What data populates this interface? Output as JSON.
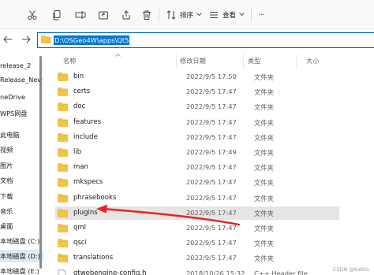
{
  "toolbar": {
    "buttons": [
      {
        "name": "cut-button",
        "icon": "scissors-icon"
      },
      {
        "name": "copy-button",
        "icon": "copy-icon"
      },
      {
        "name": "rename-button",
        "icon": "rename-icon"
      },
      {
        "name": "share-button",
        "icon": "share-icon"
      },
      {
        "name": "delete-button",
        "icon": "trash-icon"
      }
    ],
    "sort_label": "排序",
    "view_label": "查看",
    "more_label": "···"
  },
  "address_bar": {
    "path": "D:\\OSGeo4W\\apps\\Qt5"
  },
  "sidebar": {
    "items": [
      {
        "label": "release_2"
      },
      {
        "label": "Release_New_"
      },
      {
        "label": "neDrive"
      },
      {
        "label": "WPS网盘"
      },
      {
        "label": "此电脑"
      },
      {
        "label": "视频"
      },
      {
        "label": "图片"
      },
      {
        "label": "文档"
      },
      {
        "label": "下载"
      },
      {
        "label": "音乐"
      },
      {
        "label": "桌面"
      },
      {
        "label": "本地磁盘 (C:)"
      },
      {
        "label": "本地磁盘 (D:)"
      },
      {
        "label": "本地磁盘 (E:)"
      }
    ]
  },
  "columns": {
    "name": "名称",
    "date": "修改日期",
    "type": "类型",
    "size": "大小"
  },
  "files": [
    {
      "name": "bin",
      "date": "2022/9/5 17:50",
      "type": "文件夹",
      "size": "",
      "kind": "folder"
    },
    {
      "name": "certs",
      "date": "2022/9/5 17:47",
      "type": "文件夹",
      "size": "",
      "kind": "folder"
    },
    {
      "name": "doc",
      "date": "2022/9/5 17:47",
      "type": "文件夹",
      "size": "",
      "kind": "folder"
    },
    {
      "name": "features",
      "date": "2022/9/5 17:47",
      "type": "文件夹",
      "size": "",
      "kind": "folder"
    },
    {
      "name": "include",
      "date": "2022/9/5 17:47",
      "type": "文件夹",
      "size": "",
      "kind": "folder"
    },
    {
      "name": "lib",
      "date": "2022/9/5 17:49",
      "type": "文件夹",
      "size": "",
      "kind": "folder"
    },
    {
      "name": "man",
      "date": "2022/9/5 17:47",
      "type": "文件夹",
      "size": "",
      "kind": "folder"
    },
    {
      "name": "mkspecs",
      "date": "2022/9/5 17:47",
      "type": "文件夹",
      "size": "",
      "kind": "folder"
    },
    {
      "name": "phrasebooks",
      "date": "2022/9/5 17:47",
      "type": "文件夹",
      "size": "",
      "kind": "folder"
    },
    {
      "name": "plugins",
      "date": "2022/9/5 17:47",
      "type": "文件夹",
      "size": "",
      "kind": "folder"
    },
    {
      "name": "qml",
      "date": "2022/9/5 17:47",
      "type": "文件夹",
      "size": "",
      "kind": "folder"
    },
    {
      "name": "qsci",
      "date": "2022/9/5 17:47",
      "type": "文件夹",
      "size": "",
      "kind": "folder"
    },
    {
      "name": "translations",
      "date": "2022/9/5 17:47",
      "type": "文件夹",
      "size": "",
      "kind": "folder"
    },
    {
      "name": "qtwebengine-config.h",
      "date": "2018/10/26 15:32",
      "type": "C++ Header file",
      "size": "",
      "kind": "header"
    }
  ],
  "selected_file": "plugins",
  "watermark": "CSDN @Kaltro",
  "colors": {
    "accent": "#0067c0",
    "path_highlight": "#0078d7",
    "folder": "#f4c443",
    "annotation_arrow": "#e8232b"
  }
}
